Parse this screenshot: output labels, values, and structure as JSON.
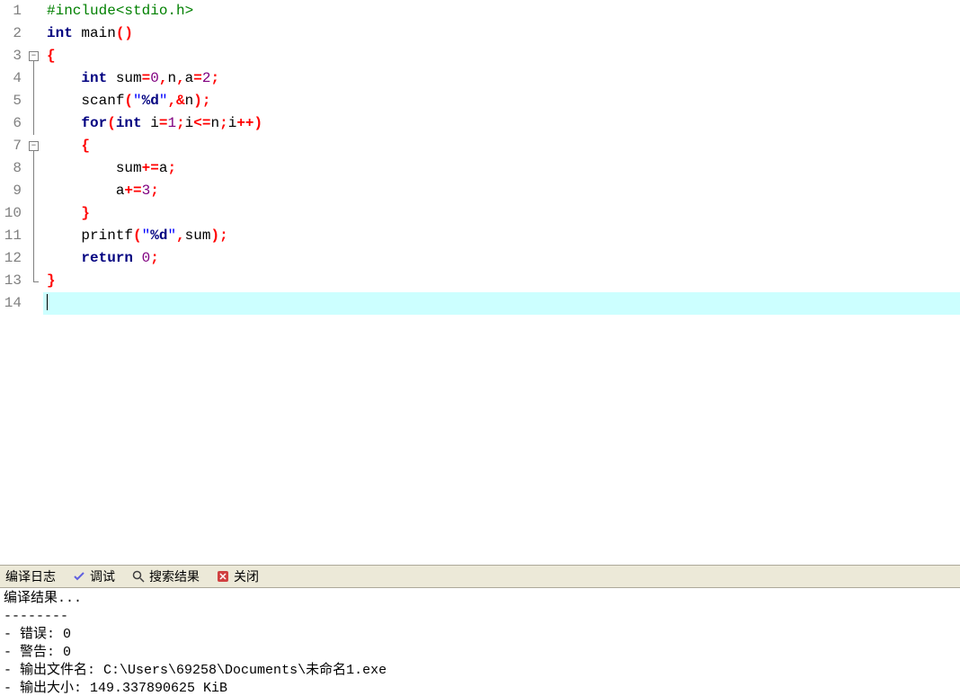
{
  "code": {
    "lines": [
      {
        "n": "1",
        "fold": "",
        "html": [
          {
            "c": "pp",
            "t": "#include<stdio.h>"
          }
        ]
      },
      {
        "n": "2",
        "fold": "",
        "html": [
          {
            "c": "kw",
            "t": "int"
          },
          {
            "t": " main"
          },
          {
            "c": "br",
            "t": "()"
          }
        ]
      },
      {
        "n": "3",
        "fold": "box",
        "html": [
          {
            "c": "br",
            "t": "{"
          }
        ]
      },
      {
        "n": "4",
        "fold": "line",
        "html": [
          {
            "t": "    "
          },
          {
            "c": "kw",
            "t": "int"
          },
          {
            "t": " sum"
          },
          {
            "c": "op",
            "t": "="
          },
          {
            "c": "num",
            "t": "0"
          },
          {
            "c": "op",
            "t": ","
          },
          {
            "t": "n"
          },
          {
            "c": "op",
            "t": ","
          },
          {
            "t": "a"
          },
          {
            "c": "op",
            "t": "="
          },
          {
            "c": "num",
            "t": "2"
          },
          {
            "c": "op",
            "t": ";"
          }
        ]
      },
      {
        "n": "5",
        "fold": "line",
        "html": [
          {
            "t": "    scanf"
          },
          {
            "c": "br",
            "t": "("
          },
          {
            "c": "str",
            "t": "\""
          },
          {
            "c": "strfmt",
            "t": "%d"
          },
          {
            "c": "str",
            "t": "\""
          },
          {
            "c": "op",
            "t": ",&"
          },
          {
            "t": "n"
          },
          {
            "c": "br",
            "t": ")"
          },
          {
            "c": "op",
            "t": ";"
          }
        ]
      },
      {
        "n": "6",
        "fold": "line",
        "html": [
          {
            "t": "    "
          },
          {
            "c": "kw",
            "t": "for"
          },
          {
            "c": "br",
            "t": "("
          },
          {
            "c": "kw",
            "t": "int"
          },
          {
            "t": " i"
          },
          {
            "c": "op",
            "t": "="
          },
          {
            "c": "num",
            "t": "1"
          },
          {
            "c": "op",
            "t": ";"
          },
          {
            "t": "i"
          },
          {
            "c": "op",
            "t": "<="
          },
          {
            "t": "n"
          },
          {
            "c": "op",
            "t": ";"
          },
          {
            "t": "i"
          },
          {
            "c": "op",
            "t": "++"
          },
          {
            "c": "br",
            "t": ")"
          }
        ]
      },
      {
        "n": "7",
        "fold": "box",
        "html": [
          {
            "t": "    "
          },
          {
            "c": "br",
            "t": "{"
          }
        ]
      },
      {
        "n": "8",
        "fold": "line",
        "html": [
          {
            "t": "        sum"
          },
          {
            "c": "op",
            "t": "+="
          },
          {
            "t": "a"
          },
          {
            "c": "op",
            "t": ";"
          }
        ]
      },
      {
        "n": "9",
        "fold": "line",
        "html": [
          {
            "t": "        a"
          },
          {
            "c": "op",
            "t": "+="
          },
          {
            "c": "num",
            "t": "3"
          },
          {
            "c": "op",
            "t": ";"
          }
        ]
      },
      {
        "n": "10",
        "fold": "line",
        "html": [
          {
            "t": "    "
          },
          {
            "c": "br",
            "t": "}"
          }
        ]
      },
      {
        "n": "11",
        "fold": "line",
        "html": [
          {
            "t": "    printf"
          },
          {
            "c": "br",
            "t": "("
          },
          {
            "c": "str",
            "t": "\""
          },
          {
            "c": "strfmt",
            "t": "%d"
          },
          {
            "c": "str",
            "t": "\""
          },
          {
            "c": "op",
            "t": ","
          },
          {
            "t": "sum"
          },
          {
            "c": "br",
            "t": ")"
          },
          {
            "c": "op",
            "t": ";"
          }
        ]
      },
      {
        "n": "12",
        "fold": "line",
        "html": [
          {
            "t": "    "
          },
          {
            "c": "kw",
            "t": "return"
          },
          {
            "t": " "
          },
          {
            "c": "num",
            "t": "0"
          },
          {
            "c": "op",
            "t": ";"
          }
        ]
      },
      {
        "n": "13",
        "fold": "end",
        "html": [
          {
            "c": "br",
            "t": "}"
          }
        ]
      },
      {
        "n": "14",
        "fold": "",
        "current": true,
        "html": [
          {
            "caret": true
          }
        ]
      }
    ]
  },
  "tabs": {
    "compile_log": "编译日志",
    "debug": "调试",
    "search_results": "搜索结果",
    "close": "关闭"
  },
  "output": {
    "title": "编译结果...",
    "sep": "--------",
    "errors_label": "- 错误:",
    "errors_count": "0",
    "warnings_label": "- 警告:",
    "warnings_count": "0",
    "outfile_label": "- 输出文件名:",
    "outfile_value": "C:\\Users\\69258\\Documents\\未命名1.exe",
    "outsize_label": "- 输出大小:",
    "outsize_value": "149.337890625 KiB"
  }
}
